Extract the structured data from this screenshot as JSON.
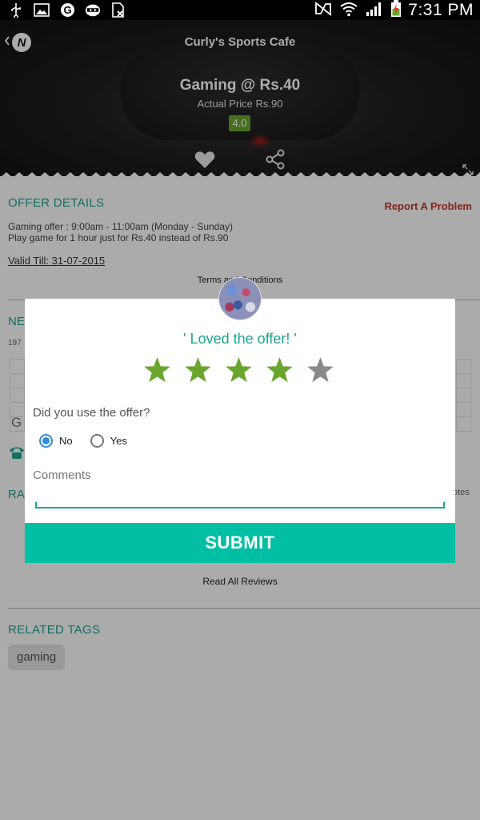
{
  "status_bar": {
    "time": "7:31 PM",
    "left_icons": [
      "usb-icon",
      "image-icon",
      "app-g-icon",
      "ninja-icon",
      "sim-card-icon"
    ],
    "right_icons": [
      "nfc-muted-icon",
      "wifi-icon",
      "signal-icon",
      "battery-charging-icon"
    ]
  },
  "hero": {
    "title": "Curly's Sports Cafe",
    "deal": "Gaming @ Rs.40",
    "actual_price": "Actual Price Rs.90",
    "rating": "4.0",
    "rating_color": "#6aa62e"
  },
  "offer": {
    "section_title": "OFFER DETAILS",
    "report_link": "Report A Problem",
    "description_line1": "Gaming offer : 9:00am - 11:00am (Monday - Sunday)",
    "description_line2": "Play game for 1 hour just for Rs.40 instead of Rs.90",
    "valid_till": "Valid Till: 31-07-2015",
    "terms_link": "Terms and Conditions"
  },
  "background_fragments": {
    "near_section": "NE",
    "address_fragment": "197",
    "map_fragment": "G",
    "ratings_section": "RA",
    "votes_fragment": "otes"
  },
  "reviews": {
    "read_all": "Read All Reviews"
  },
  "tags": {
    "section_title": "RELATED TAGS",
    "items": [
      "gaming"
    ]
  },
  "dialog": {
    "headline": "' Loved the offer! '",
    "rating": {
      "value": 4,
      "max": 5,
      "active_color": "#6aa62e",
      "inactive_color": "#8a8a8a"
    },
    "question": "Did you use the offer?",
    "options": [
      {
        "label": "No",
        "selected": true
      },
      {
        "label": "Yes",
        "selected": false
      }
    ],
    "comments_placeholder": "Comments",
    "comments_value": "",
    "submit_label": "SUBMIT",
    "accent_color": "#00bfa5"
  }
}
